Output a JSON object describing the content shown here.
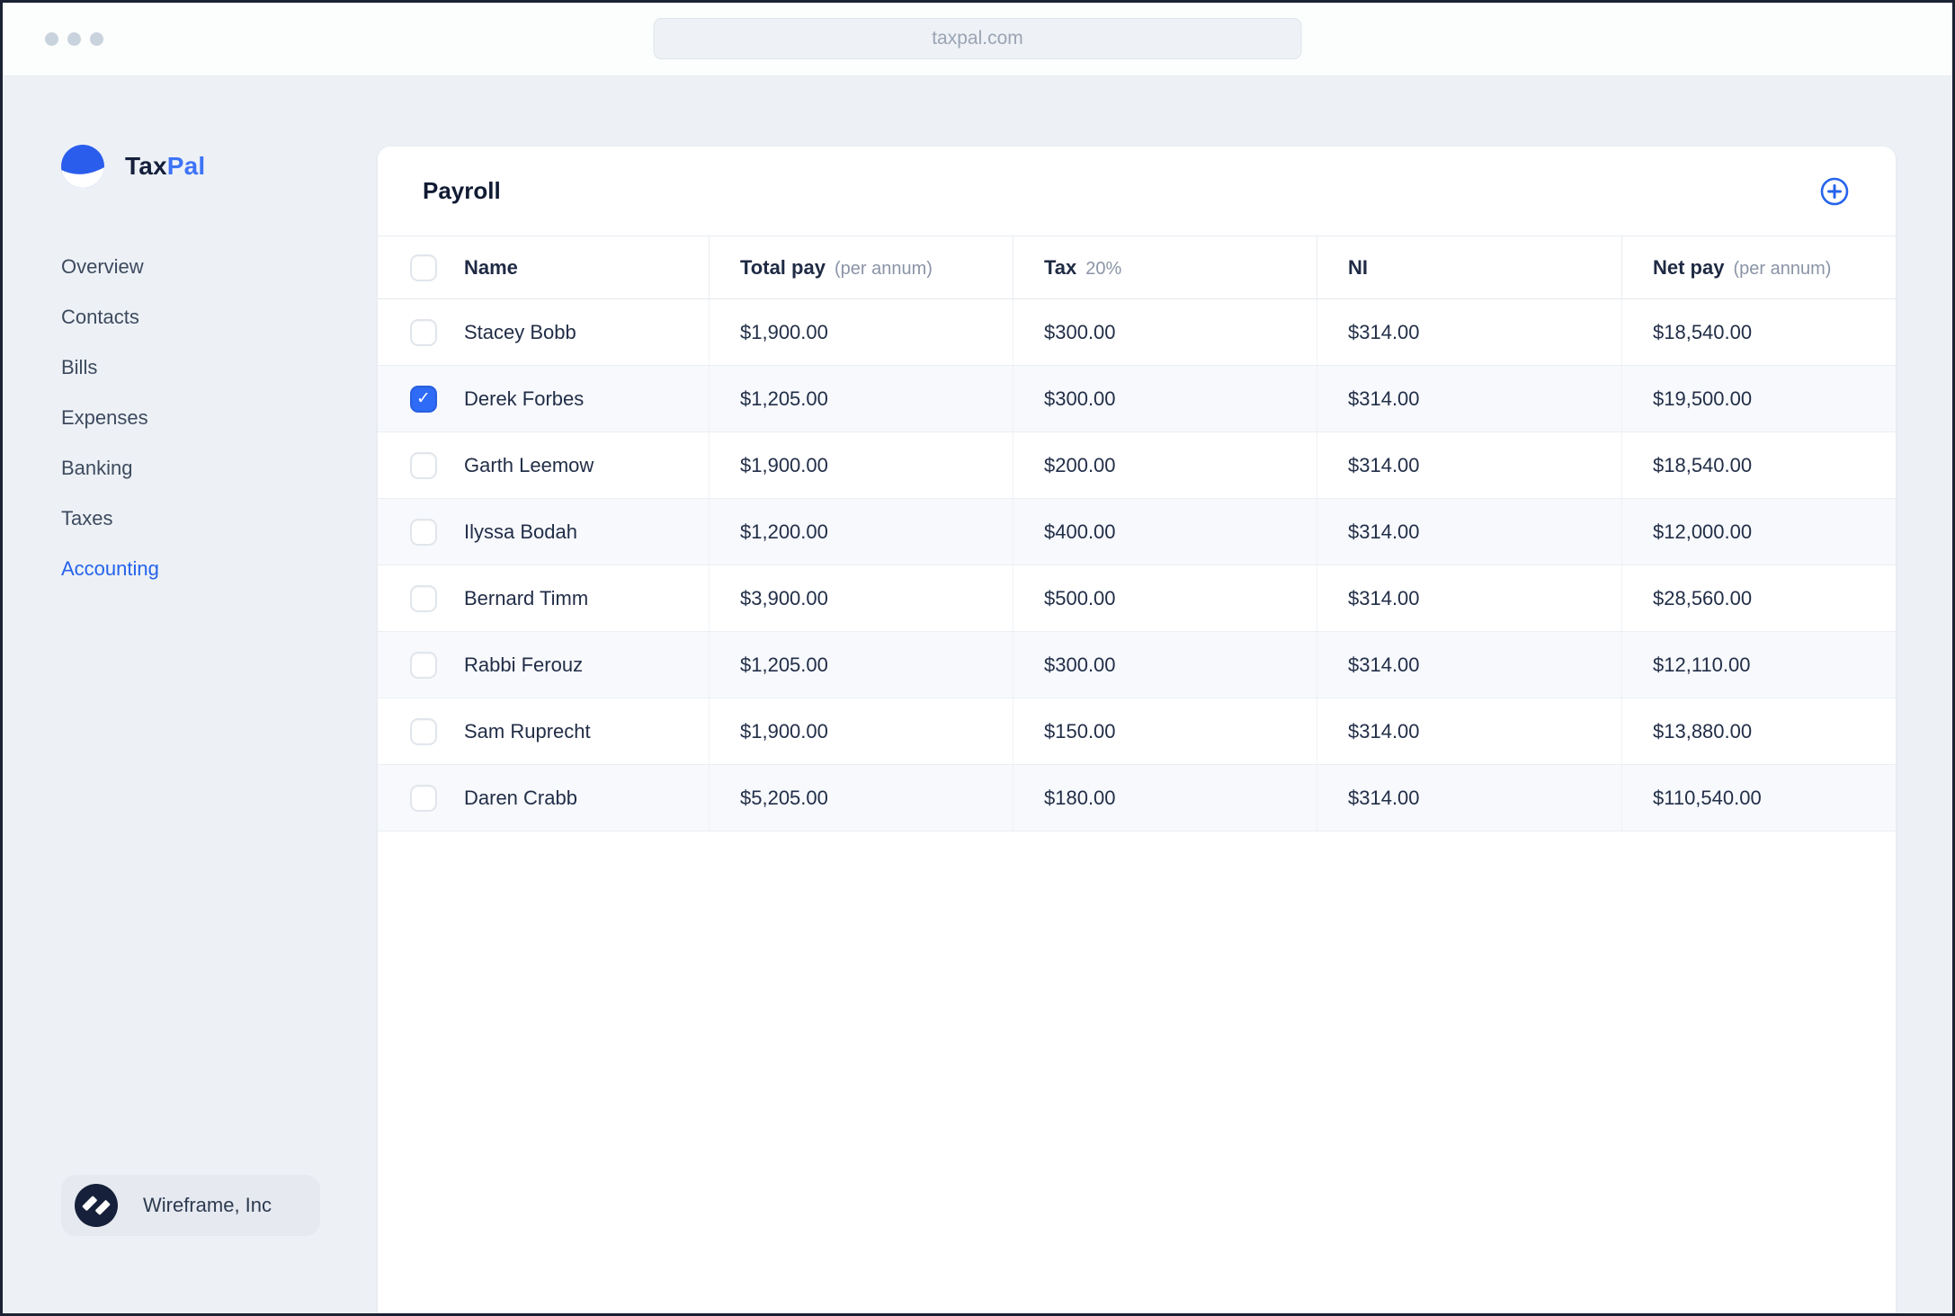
{
  "browser": {
    "url": "taxpal.com"
  },
  "brand": {
    "primary": "Tax",
    "secondary": "Pal"
  },
  "sidebar": {
    "items": [
      {
        "label": "Overview",
        "active": false
      },
      {
        "label": "Contacts",
        "active": false
      },
      {
        "label": "Bills",
        "active": false
      },
      {
        "label": "Expenses",
        "active": false
      },
      {
        "label": "Banking",
        "active": false
      },
      {
        "label": "Taxes",
        "active": false
      },
      {
        "label": "Accounting",
        "active": true
      }
    ],
    "org_name": "Wireframe, Inc"
  },
  "payroll": {
    "title": "Payroll",
    "columns": [
      {
        "label": "Name",
        "sub": ""
      },
      {
        "label": "Total pay",
        "sub": "(per annum)"
      },
      {
        "label": "Tax",
        "sub": "20%"
      },
      {
        "label": "NI",
        "sub": ""
      },
      {
        "label": "Net pay",
        "sub": "(per annum)"
      }
    ],
    "rows": [
      {
        "name": "Stacey Bobb",
        "checked": false,
        "total_pay": "$1,900.00",
        "tax": "$300.00",
        "ni": "$314.00",
        "net_pay": "$18,540.00"
      },
      {
        "name": "Derek Forbes",
        "checked": true,
        "total_pay": "$1,205.00",
        "tax": "$300.00",
        "ni": "$314.00",
        "net_pay": "$19,500.00"
      },
      {
        "name": "Garth Leemow",
        "checked": false,
        "total_pay": "$1,900.00",
        "tax": "$200.00",
        "ni": "$314.00",
        "net_pay": "$18,540.00"
      },
      {
        "name": "Ilyssa Bodah",
        "checked": false,
        "total_pay": "$1,200.00",
        "tax": "$400.00",
        "ni": "$314.00",
        "net_pay": "$12,000.00"
      },
      {
        "name": "Bernard Timm",
        "checked": false,
        "total_pay": "$3,900.00",
        "tax": "$500.00",
        "ni": "$314.00",
        "net_pay": "$28,560.00"
      },
      {
        "name": "Rabbi Ferouz",
        "checked": false,
        "total_pay": "$1,205.00",
        "tax": "$300.00",
        "ni": "$314.00",
        "net_pay": "$12,110.00"
      },
      {
        "name": "Sam Ruprecht",
        "checked": false,
        "total_pay": "$1,900.00",
        "tax": "$150.00",
        "ni": "$314.00",
        "net_pay": "$13,880.00"
      },
      {
        "name": "Daren Crabb",
        "checked": false,
        "total_pay": "$5,205.00",
        "tax": "$180.00",
        "ni": "$314.00",
        "net_pay": "$110,540.00"
      }
    ]
  },
  "colors": {
    "accent": "#2563eb",
    "logo_blue": "#2b5ded",
    "checkbox_checked": "#2e6bf6",
    "brand_navy": "#16203a",
    "page_background": "#edf1f6"
  }
}
